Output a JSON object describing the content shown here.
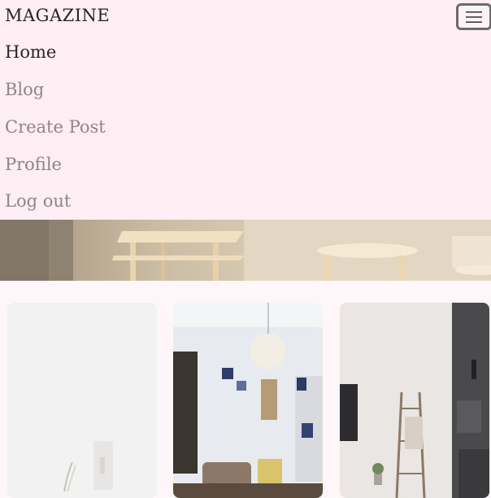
{
  "navbar": {
    "brand": "MAGAZINE",
    "toggle_icon": "hamburger-icon",
    "items": [
      {
        "label": "Home",
        "active": true
      },
      {
        "label": "Blog",
        "active": false
      },
      {
        "label": "Create Post",
        "active": false
      },
      {
        "label": "Profile",
        "active": false
      },
      {
        "label": "Log out",
        "active": false
      }
    ]
  },
  "colors": {
    "navbar_bg": "#ffeef4",
    "page_bg": "#fff6f9",
    "active_text": "#2b2623",
    "inactive_text": "#8e8682"
  },
  "hero": {
    "image": "stool-furniture-image"
  },
  "cards": [
    {
      "image": "white-wall-vase-image"
    },
    {
      "image": "living-room-chandelier-image"
    },
    {
      "image": "ladder-shelf-interior-image"
    }
  ]
}
